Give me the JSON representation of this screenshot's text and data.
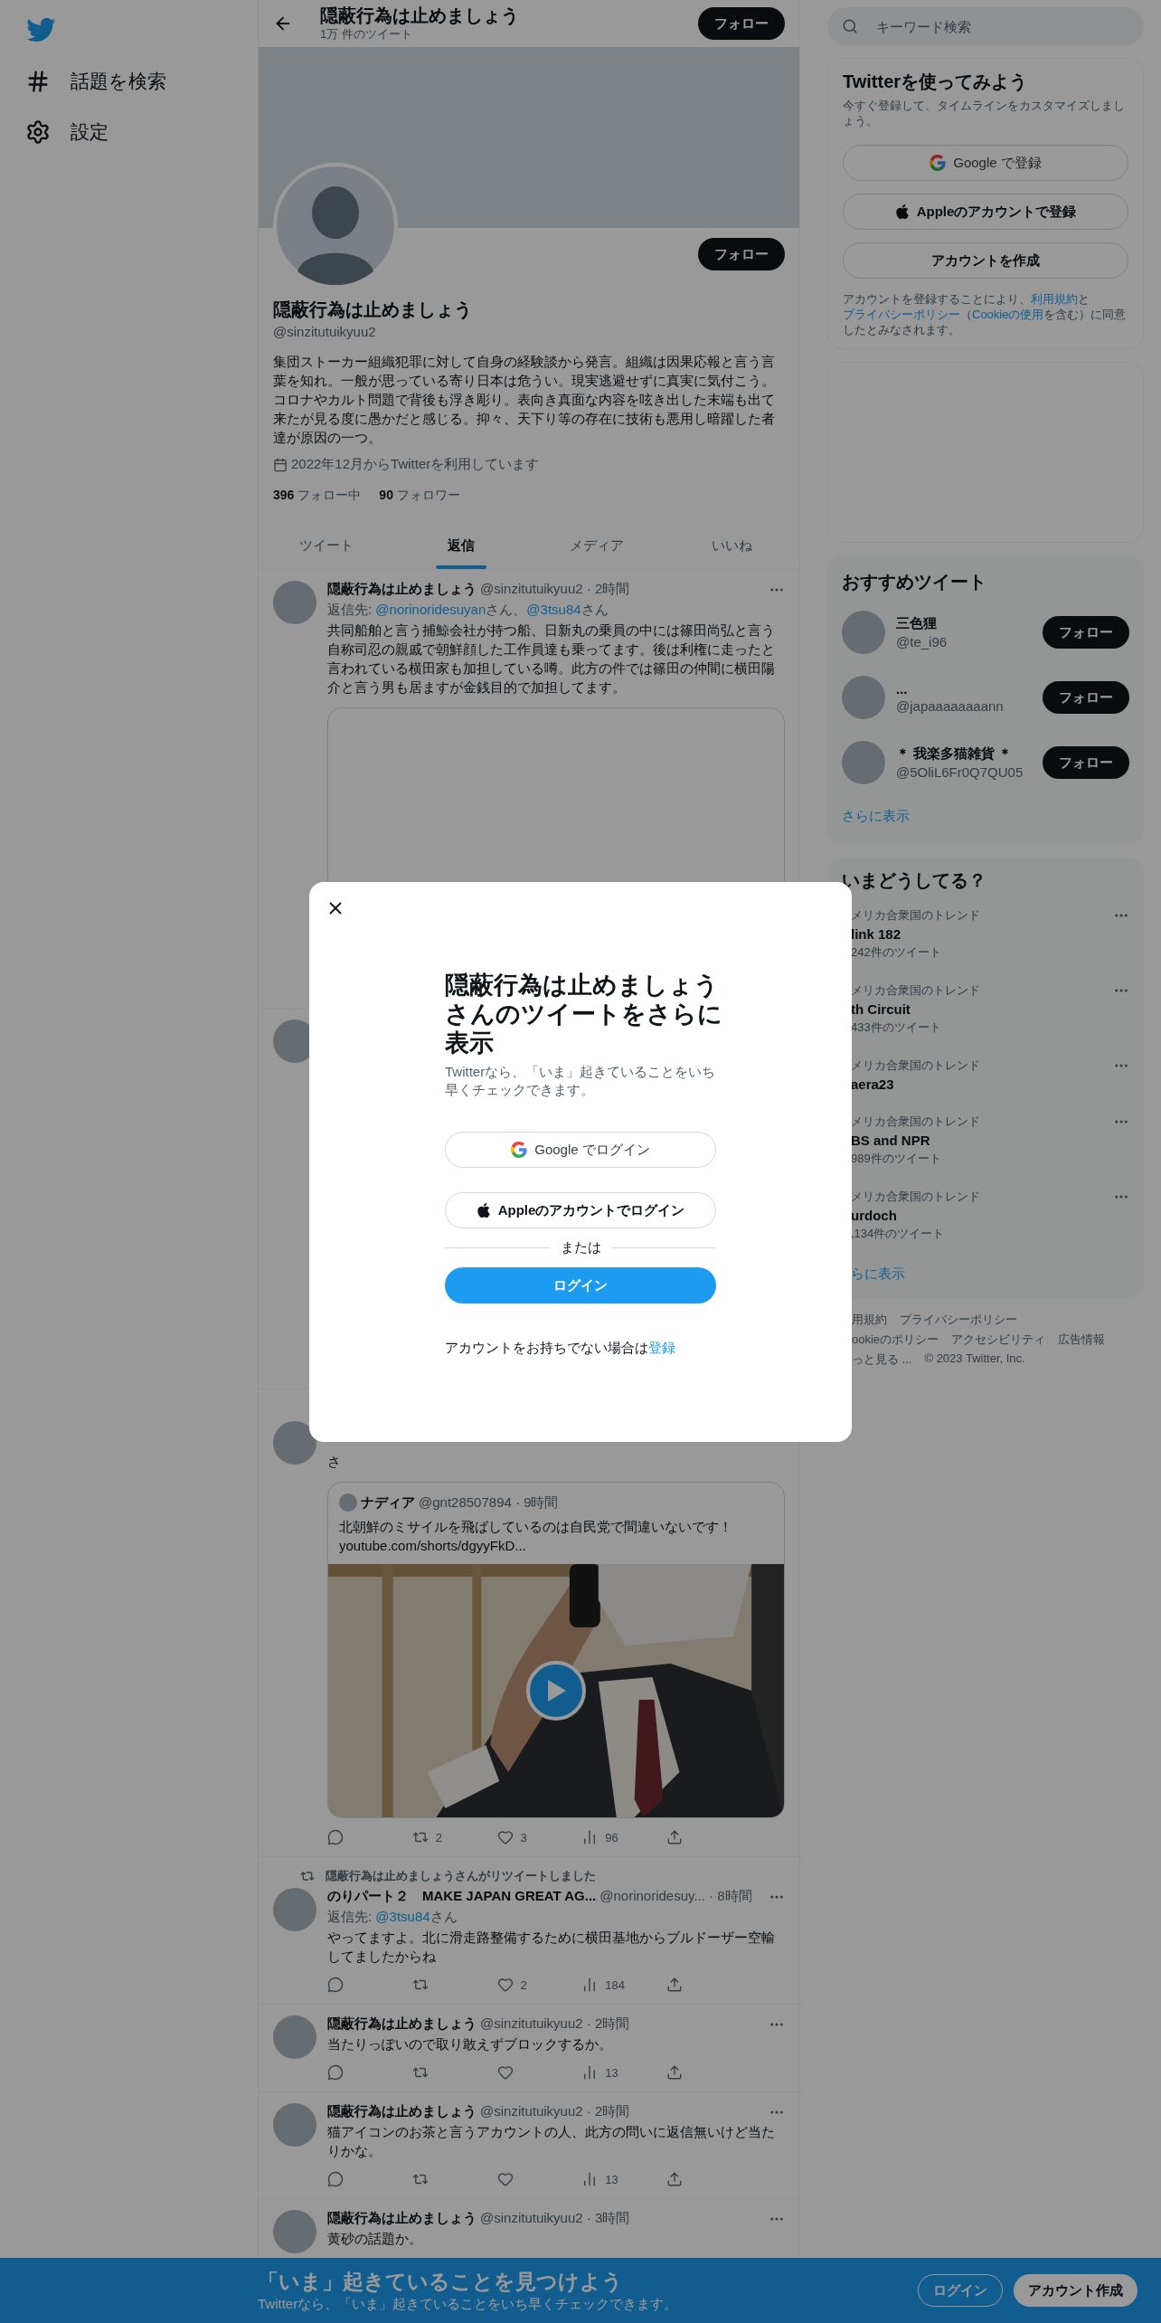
{
  "nav": {
    "items": [
      {
        "label": "話題を検索"
      },
      {
        "label": "設定"
      }
    ]
  },
  "header": {
    "title": "隠蔽行為は止めましょう",
    "tweet_count": "1万 件のツイート",
    "follow": "フォロー"
  },
  "profile": {
    "follow": "フォロー",
    "name": "隠蔽行為は止めましょう",
    "handle": "@sinzitutuikyuu2",
    "bio": "集団ストーカー組織犯罪に対して自身の経験談から発言。組織は因果応報と言う言葉を知れ。一般が思っている寄り日本は危うい。現実逃避せずに真実に気付こう。コロナやカルト問題で背後も浮き彫り。表向き真面な内容を呟き出した末端も出て来たが見る度に愚かだと感じる。抑々、天下り等の存在に技術も悪用し暗躍した者達が原因の一つ。",
    "joined": "2022年12月からTwitterを利用しています",
    "following_count": "396",
    "following_label": "フォロー中",
    "followers_count": "90",
    "followers_label": "フォロワー"
  },
  "tabs": [
    {
      "label": "ツイート",
      "selected": false
    },
    {
      "label": "返信",
      "selected": true
    },
    {
      "label": "メディア",
      "selected": false
    },
    {
      "label": "いいね",
      "selected": false
    }
  ],
  "tweets": [
    {
      "kind": "tweet",
      "name": "隠蔽行為は止めましょう",
      "meta": "@sinzitutuikyuu2 · 2時間",
      "reply": [
        {
          "text": "返信先: ",
          "link": false
        },
        {
          "text": "@norinoridesuyan",
          "link": true
        },
        {
          "text": "さん、",
          "link": false
        },
        {
          "text": "@3tsu84",
          "link": true
        },
        {
          "text": "さん",
          "link": false
        }
      ],
      "text": "共同船舶と言う捕鯨会社が持つ船、日新丸の乗員の中には篠田尚弘と言う自称司忍の親戚で朝鮮顔した工作員達も乗ってます。後は利権に走ったと言われている横田家も加担している噂。此方の件では篠田の仲間に横田陽介と言う男も居ますが金銭目的で加担してます。",
      "media": {
        "kind": "blank"
      }
    },
    {
      "kind": "covered"
    },
    {
      "kind": "continued",
      "text": "さ",
      "quote": {
        "name": "ナディア",
        "meta": "@gnt28507894 · 9時間",
        "text": "北朝鮮のミサイルを飛ばしているのは自民党で間違いないです！",
        "link": "youtube.com/shorts/dgyyFkD..."
      },
      "actions": {
        "retweets": "2",
        "likes": "3",
        "views": "96"
      }
    },
    {
      "kind": "tweet",
      "retweeted_by": "隠蔽行為は止めましょうさんがリツイートしました",
      "name": "のりパート２　MAKE JAPAN GREAT AG...",
      "meta": "@norinoridesuy... · 8時間",
      "reply": [
        {
          "text": "返信先: ",
          "link": false
        },
        {
          "text": "@3tsu84",
          "link": true
        },
        {
          "text": "さん",
          "link": false
        }
      ],
      "text": "やってますよ。北に滑走路整備するために横田基地からブルドーザー空輸してましたからね",
      "actions": {
        "likes": "2",
        "views": "184"
      }
    },
    {
      "kind": "tweet",
      "name": "隠蔽行為は止めましょう",
      "meta": "@sinzitutuikyuu2 · 2時間",
      "text": "当たりっぽいので取り敢えずブロックするか。",
      "actions": {
        "views": "13"
      }
    },
    {
      "kind": "tweet",
      "name": "隠蔽行為は止めましょう",
      "meta": "@sinzitutuikyuu2 · 2時間",
      "text": "猫アイコンのお茶と言うアカウントの人、此方の問いに返信無いけど当たりかな。",
      "actions": {
        "views": "13"
      }
    },
    {
      "kind": "tweet",
      "name": "隠蔽行為は止めましょう",
      "meta": "@sinzitutuikyuu2 · 3時間",
      "text": "黄砂の話題か。"
    }
  ],
  "search": {
    "placeholder": "キーワード検索"
  },
  "signup": {
    "title": "Twitterを使ってみよう",
    "subtitle": "今すぐ登録して、タイムラインをカスタマイズしましょう。",
    "buttons": [
      {
        "kind": "google",
        "label": "Google で登録"
      },
      {
        "kind": "apple",
        "label": "Appleのアカウントで登録"
      },
      {
        "kind": "plain",
        "label": "アカウントを作成"
      }
    ],
    "terms": [
      {
        "text": "アカウントを登録することにより、",
        "link": false
      },
      {
        "text": "利用規約",
        "link": true
      },
      {
        "text": "と",
        "link": false
      },
      {
        "text": "プライバシーポリシー",
        "link": true
      },
      {
        "text": "（",
        "link": false
      },
      {
        "text": "Cookieの使用",
        "link": true
      },
      {
        "text": "を含む）に同意したとみなされます。",
        "link": false
      }
    ]
  },
  "recommended": {
    "title": "おすすめツイート",
    "users": [
      {
        "name": "三色狸",
        "handle": "@te_i96",
        "follow": "フォロー"
      },
      {
        "name": "...",
        "handle": "@japaaaaaaaann",
        "follow": "フォロー"
      },
      {
        "name": "＊ 我楽多猫雑貨 ＊",
        "handle": "@5OliL6Fr0Q7QU05",
        "follow": "フォロー"
      }
    ],
    "more": "さらに表示"
  },
  "trends": {
    "title": "いまどうしてる？",
    "items": [
      {
        "context": "メリカ合衆国のトレンド",
        "topic": "link 182",
        "count": "242件のツイート"
      },
      {
        "context": "メリカ合衆国のトレンド",
        "topic": "th Circuit",
        "count": "433件のツイート"
      },
      {
        "context": "メリカ合衆国のトレンド",
        "topic": "aera23"
      },
      {
        "context": "メリカ合衆国のトレンド",
        "topic": "BS and NPR",
        "count": "989件のツイート"
      },
      {
        "context": "メリカ合衆国のトレンド",
        "topic": "urdoch",
        "count": ",134件のツイート"
      }
    ],
    "more": "らに表示"
  },
  "footer": [
    [
      "用規約",
      "プライバシーポリシー"
    ],
    [
      "ookieのポリシー",
      "アクセシビリティ",
      "広告情報"
    ],
    [
      "っと見る ...",
      "© 2023 Twitter, Inc."
    ]
  ],
  "modal": {
    "title": "隠蔽行為は止めましょうさんのツイートをさらに表示",
    "subtitle": "Twitterなら、「いま」起きていることをいち早くチェックできます。",
    "buttons": [
      {
        "kind": "google",
        "label": "Google でログイン"
      },
      {
        "kind": "apple",
        "label": "Appleのアカウントでログイン"
      }
    ],
    "divider": "または",
    "login": "ログイン",
    "prompt": "アカウントをお持ちでない場合は",
    "prompt_link": "登録"
  },
  "banner": {
    "title": "「いま」起きていることを見つけよう",
    "subtitle": "Twitterなら、「いま」起きていることをいち早くチェックできます。",
    "buttons": [
      {
        "kind": "outline",
        "label": "ログイン"
      },
      {
        "kind": "filled",
        "label": "アカウント作成"
      }
    ]
  }
}
